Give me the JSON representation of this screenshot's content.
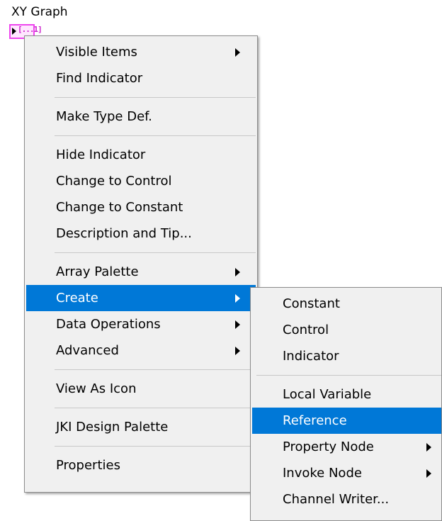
{
  "graph": {
    "title": "XY Graph",
    "terminal_text": "[...1]"
  },
  "main_menu": {
    "items": [
      {
        "label": "Visible Items",
        "submenu": true
      },
      {
        "label": "Find Indicator",
        "submenu": false
      },
      {
        "label": "Make Type Def.",
        "submenu": false
      },
      {
        "label": "Hide Indicator",
        "submenu": false
      },
      {
        "label": "Change to Control",
        "submenu": false
      },
      {
        "label": "Change to Constant",
        "submenu": false
      },
      {
        "label": "Description and Tip...",
        "submenu": false
      },
      {
        "label": "Array Palette",
        "submenu": true
      },
      {
        "label": "Create",
        "submenu": true,
        "highlighted": true
      },
      {
        "label": "Data Operations",
        "submenu": true
      },
      {
        "label": "Advanced",
        "submenu": true
      },
      {
        "label": "View As Icon",
        "submenu": false
      },
      {
        "label": "JKI Design Palette",
        "submenu": false
      },
      {
        "label": "Properties",
        "submenu": false
      }
    ]
  },
  "create_submenu": {
    "items": [
      {
        "label": "Constant",
        "submenu": false
      },
      {
        "label": "Control",
        "submenu": false
      },
      {
        "label": "Indicator",
        "submenu": false
      },
      {
        "label": "Local Variable",
        "submenu": false
      },
      {
        "label": "Reference",
        "submenu": false,
        "highlighted": true
      },
      {
        "label": "Property Node",
        "submenu": true
      },
      {
        "label": "Invoke Node",
        "submenu": true
      },
      {
        "label": "Channel Writer...",
        "submenu": false
      }
    ]
  },
  "colors": {
    "highlight": "#0078d7",
    "menu_bg": "#f0f0f0",
    "terminal_border": "#ee44ee"
  }
}
